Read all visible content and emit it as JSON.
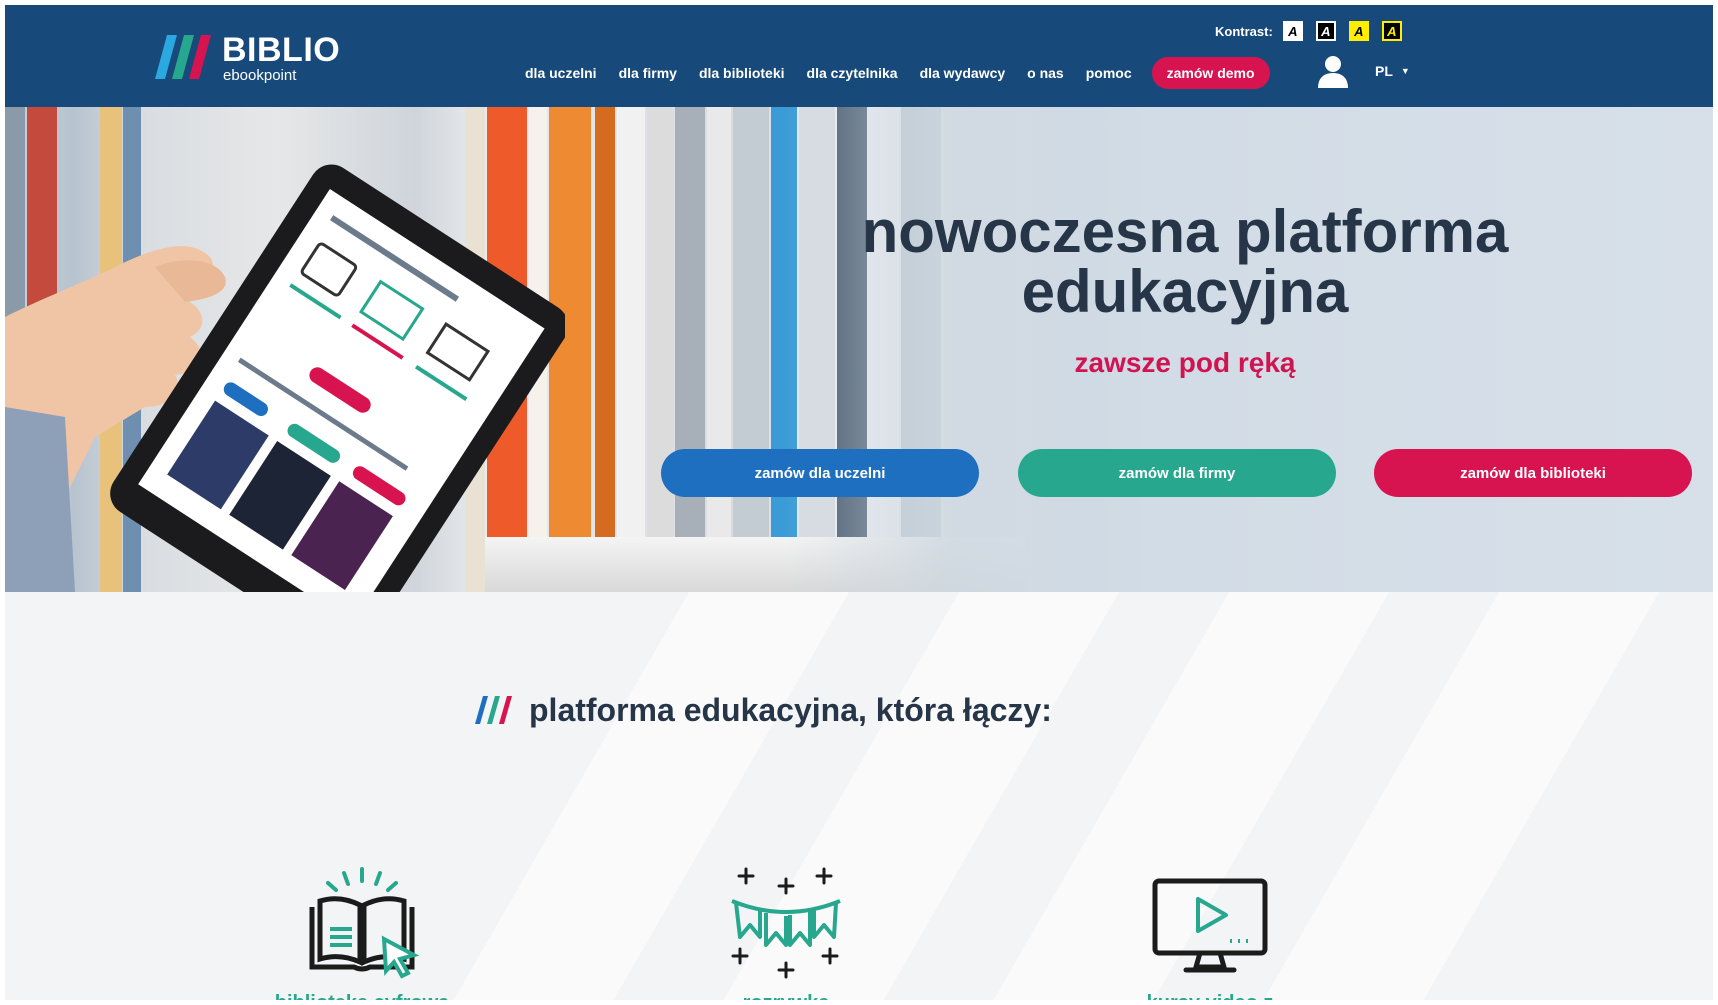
{
  "header": {
    "logo_title": "BIBLIO",
    "logo_subtitle": "ebookpoint",
    "contrast_label": "Kontrast:",
    "contrast_options": [
      "A",
      "A",
      "A",
      "A"
    ],
    "nav": [
      "dla uczelni",
      "dla firmy",
      "dla biblioteki",
      "dla czytelnika",
      "dla wydawcy",
      "o nas",
      "pomoc"
    ],
    "demo_button": "zamów demo",
    "language": "PL"
  },
  "hero": {
    "title_line1": "nowoczesna platforma",
    "title_line2": "edukacyjna",
    "subtitle": "zawsze pod ręką",
    "buttons": [
      "zamów dla uczelni",
      "zamów dla firmy",
      "zamów dla biblioteki"
    ]
  },
  "section": {
    "title": "platforma edukacyjna, która łączy:",
    "features": [
      {
        "label": "bibliotekę cyfrową",
        "icon": "open-book-icon"
      },
      {
        "label": "rozrywkę",
        "icon": "garland-icon"
      },
      {
        "label": "kursy video z",
        "icon": "monitor-play-icon"
      }
    ]
  },
  "colors": {
    "header_bg": "#174a7a",
    "accent_pink": "#d81450",
    "accent_teal": "#27a88e",
    "accent_blue": "#1e6fc0",
    "heading": "#263648"
  }
}
